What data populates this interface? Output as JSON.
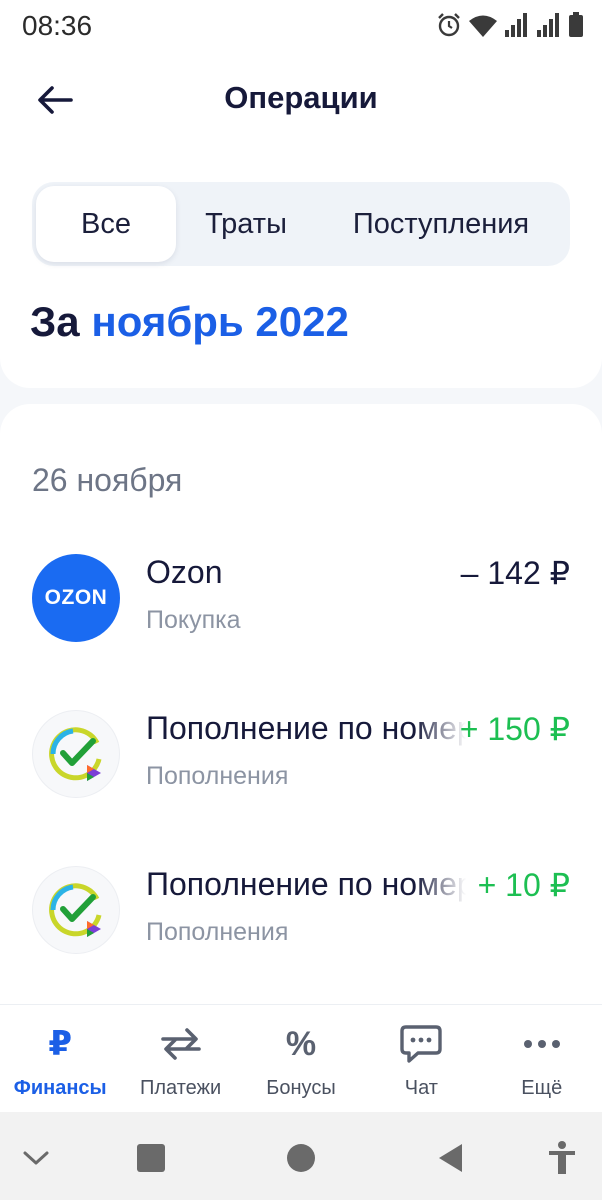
{
  "status_bar": {
    "time": "08:36"
  },
  "header": {
    "title": "Операции"
  },
  "tabs": [
    {
      "label": "Все",
      "active": true
    },
    {
      "label": "Траты",
      "active": false
    },
    {
      "label": "Поступления",
      "active": false
    }
  ],
  "period": {
    "prefix": "За",
    "month": "ноябрь 2022"
  },
  "operations": {
    "date_label": "26 ноября",
    "items": [
      {
        "icon_text": "OZON",
        "icon": "ozon-logo",
        "title": "Ozon",
        "subtitle": "Покупка",
        "amount": "– 142 ₽",
        "type": "debit"
      },
      {
        "icon": "sbp-logo",
        "title": "Пополнение по номеру",
        "subtitle": "Пополнения",
        "amount": "+ 150 ₽",
        "type": "credit"
      },
      {
        "icon": "sbp-logo",
        "title": "Пополнение по номеру",
        "subtitle": "Пополнения",
        "amount": "+ 10 ₽",
        "type": "credit"
      }
    ]
  },
  "bottom_nav": [
    {
      "label": "Финансы",
      "icon": "ruble-icon",
      "glyph": "₽",
      "active": true
    },
    {
      "label": "Платежи",
      "icon": "transfer-icon",
      "active": false
    },
    {
      "label": "Бонусы",
      "icon": "percent-icon",
      "glyph": "%",
      "active": false
    },
    {
      "label": "Чат",
      "icon": "chat-icon",
      "active": false
    },
    {
      "label": "Ещё",
      "icon": "more-icon",
      "active": false
    }
  ],
  "colors": {
    "accent": "#1b5fe6",
    "positive": "#1dbf52",
    "ozon": "#1a6bf2",
    "text": "#16193a"
  }
}
